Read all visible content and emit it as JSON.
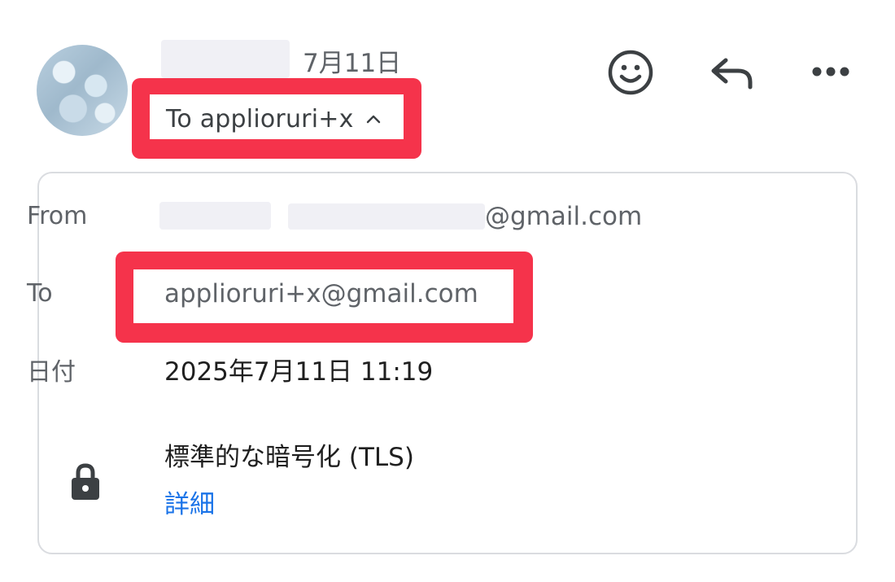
{
  "header": {
    "date": "7月11日",
    "recipient_summary": "To applioruri+x"
  },
  "details": {
    "from_label": "From",
    "from_domain": "@gmail.com",
    "to_label": "To",
    "to_value": "applioruri+x@gmail.com",
    "date_label": "日付",
    "date_value": "2025年7月11日 11:19",
    "encryption_text": "標準的な暗号化 (TLS)",
    "encryption_link": "詳細"
  },
  "colors": {
    "highlight": "#f5334b",
    "link": "#1a73e8"
  },
  "icons": [
    "emoji-icon",
    "reply-icon",
    "more-options-icon",
    "chevron-up-icon",
    "lock-icon"
  ]
}
